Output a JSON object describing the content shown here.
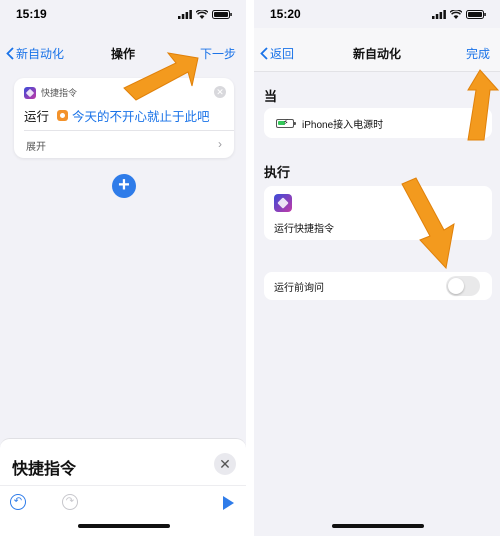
{
  "left": {
    "status": {
      "time": "15:19"
    },
    "nav": {
      "back_label": "新自动化",
      "title": "操作",
      "next_label": "下一步"
    },
    "action_card": {
      "app_name": "快捷指令",
      "run_label": "运行",
      "shortcut_name": "今天的不开心就止于此吧",
      "expand_label": "展开",
      "close_glyph": "✕",
      "chevron_glyph": "›"
    },
    "add_glyph": "+",
    "sheet": {
      "title": "快捷指令",
      "close_glyph": "✕",
      "undo_glyph": "↶",
      "redo_glyph": "↷"
    }
  },
  "right": {
    "status": {
      "time": "15:20"
    },
    "nav": {
      "back_label": "返回",
      "title": "新自动化",
      "done_label": "完成"
    },
    "when_label": "当",
    "trigger_text": "iPhone接入电源时",
    "do_label": "执行",
    "action_text": "运行快捷指令",
    "ask_label": "运行前询问",
    "ask_enabled": false
  },
  "colors": {
    "accent": "#1a73e8",
    "arrow": "#f39a1e"
  },
  "icons": [
    "chevron-left-icon",
    "shortcuts-icon",
    "close-icon",
    "chevron-right-icon",
    "plus-icon",
    "undo-icon",
    "redo-icon",
    "play-icon",
    "battery-charging-icon",
    "wifi-icon",
    "signal-icon",
    "battery-icon"
  ]
}
